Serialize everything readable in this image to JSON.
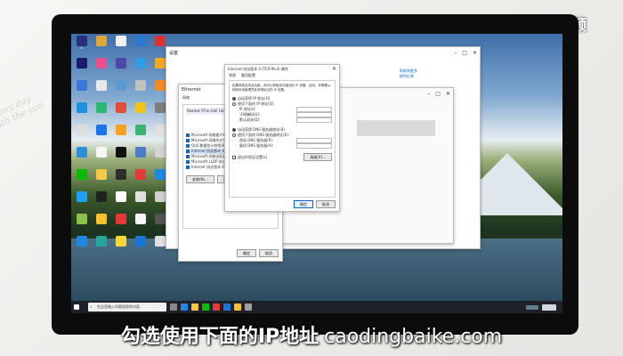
{
  "watermark": "天奇·视频",
  "caption": {
    "main": "勾选使用下面的IP地址",
    "site": "caodingbaike.com"
  },
  "settings_window": {
    "title_left": "设置",
    "heading": "状态",
    "right_links": [
      "帮助和更多",
      "提供反馈"
    ]
  },
  "ethernet_props": {
    "title": "Ethernet",
    "tab": "网络",
    "adapter": "Realtek PCIe GbE Family Controller",
    "buttons": [
      "安装(N)...",
      "卸载(U)",
      "属性(R)"
    ],
    "ok": "确定",
    "cancel": "取消"
  },
  "ipv4_dialog": {
    "title": "Internet 协议版本 4 (TCP/IPv4) 属性",
    "tabs": [
      "常规",
      "备用配置"
    ],
    "desc": "如果网络支持此功能，则可以获取自动指派的 IP 设置。否则，你需要从网络系统管理员处获得适当的 IP 设置。",
    "radio_auto_ip": "自动获得 IP 地址(O)",
    "radio_manual_ip": "使用下面的 IP 地址(S):",
    "ip_label": "IP 地址(I):",
    "mask_label": "子网掩码(U):",
    "gateway_label": "默认网关(D):",
    "radio_auto_dns": "自动获得 DNS 服务器地址(B)",
    "radio_manual_dns": "使用下面的 DNS 服务器地址(E):",
    "dns1_label": "首选 DNS 服务器(P):",
    "dns2_label": "备用 DNS 服务器(A):",
    "validate": "退出时验证设置(L)",
    "advanced": "高级(V)...",
    "ok": "确定",
    "cancel": "取消"
  },
  "taskbar": {
    "search_placeholder": "在这里输入你要搜索的内容"
  },
  "colors": {
    "accent": "#0a64c8",
    "taskbar": "#1f2128"
  }
}
